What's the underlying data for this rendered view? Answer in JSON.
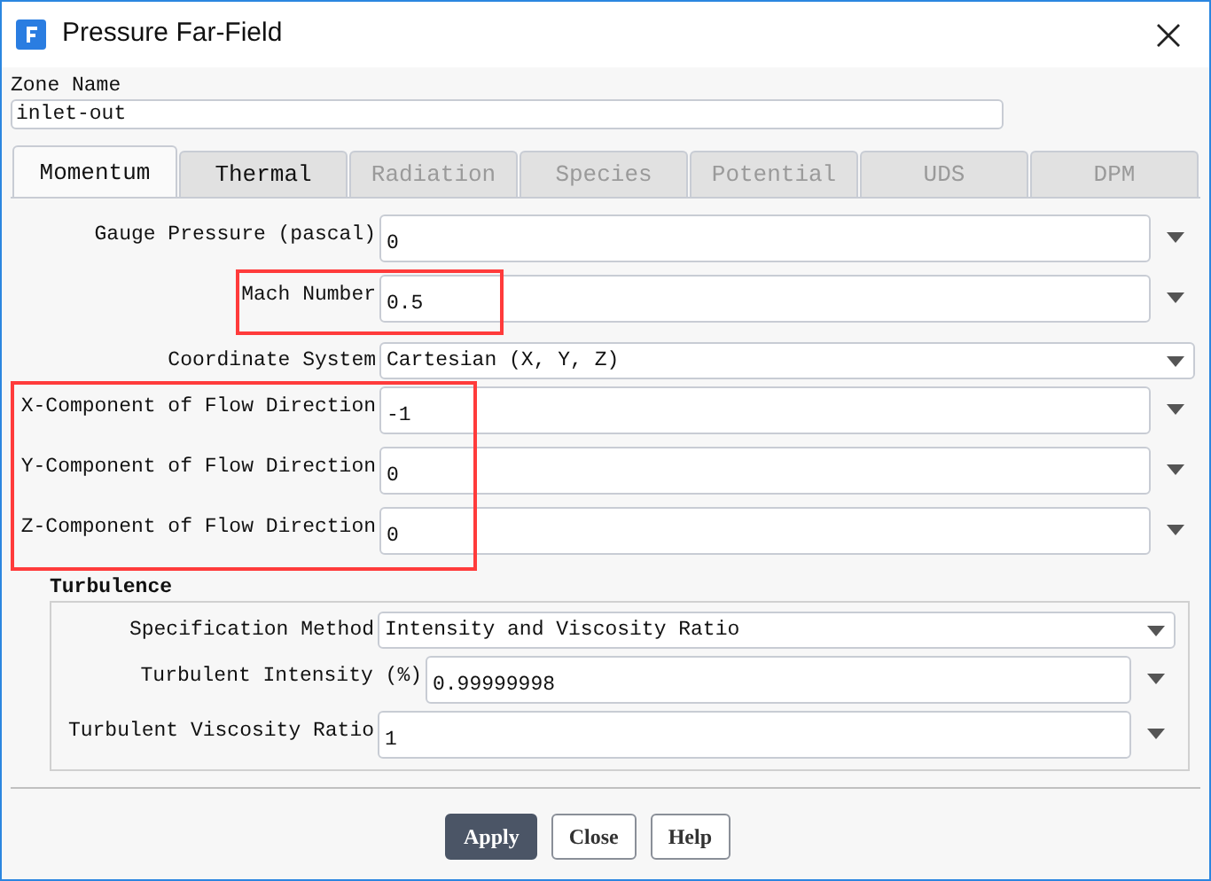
{
  "window": {
    "title": "Pressure Far-Field"
  },
  "zone": {
    "label": "Zone Name",
    "value": "inlet-out"
  },
  "tabs": [
    {
      "label": "Momentum",
      "selected": true,
      "disabled": false
    },
    {
      "label": "Thermal",
      "selected": false,
      "disabled": false
    },
    {
      "label": "Radiation",
      "selected": false,
      "disabled": true
    },
    {
      "label": "Species",
      "selected": false,
      "disabled": true
    },
    {
      "label": "Potential",
      "selected": false,
      "disabled": true
    },
    {
      "label": "UDS",
      "selected": false,
      "disabled": true
    },
    {
      "label": "DPM",
      "selected": false,
      "disabled": true
    }
  ],
  "momentum": [
    {
      "highlighted": false,
      "rows": [
        {
          "kind": "input",
          "label": "Gauge Pressure (pascal)",
          "value": "0"
        }
      ]
    },
    {
      "highlighted": true,
      "rows": [
        {
          "kind": "input",
          "label": "Mach Number",
          "value": "0.5"
        }
      ]
    },
    {
      "highlighted": false,
      "rows": [
        {
          "kind": "select",
          "label": "Coordinate System",
          "value": "Cartesian (X, Y, Z)"
        }
      ]
    },
    {
      "highlighted": true,
      "rows": [
        {
          "kind": "input",
          "label": "X-Component of Flow Direction",
          "value": "-1"
        },
        {
          "kind": "input",
          "label": "Y-Component of Flow Direction",
          "value": "0"
        },
        {
          "kind": "input",
          "label": "Z-Component of Flow Direction",
          "value": "0"
        }
      ]
    }
  ],
  "turbulence": {
    "title": "Turbulence",
    "rows": [
      {
        "kind": "select",
        "label": "Specification Method",
        "value": "Intensity and Viscosity Ratio"
      },
      {
        "kind": "input",
        "label": "Turbulent Intensity (%)",
        "value": "0.99999998"
      },
      {
        "kind": "input",
        "label": "Turbulent Viscosity Ratio",
        "value": "1"
      }
    ]
  },
  "buttons": [
    {
      "label": "Apply",
      "kind": "primary"
    },
    {
      "label": "Close",
      "kind": "default"
    },
    {
      "label": "Help",
      "kind": "default"
    }
  ]
}
